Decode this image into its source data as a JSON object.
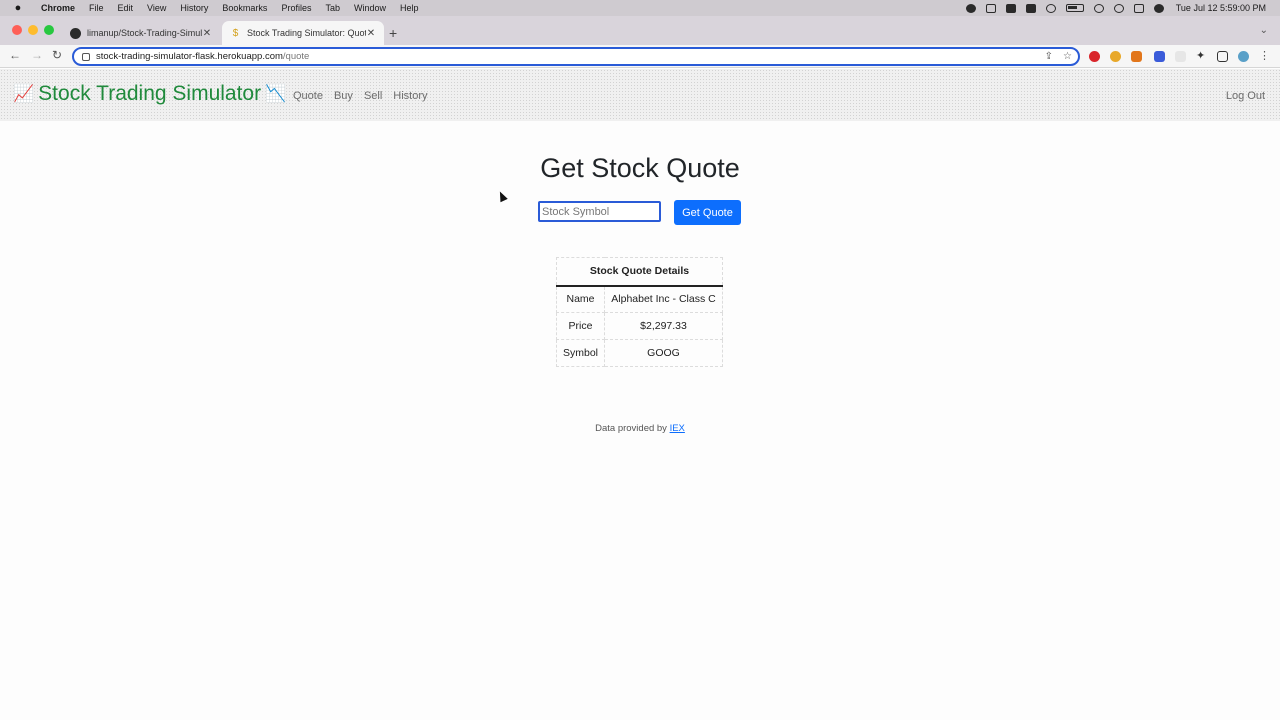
{
  "menubar": {
    "app": "Chrome",
    "items": [
      "File",
      "Edit",
      "View",
      "History",
      "Bookmarks",
      "Profiles",
      "Tab",
      "Window",
      "Help"
    ],
    "clock": "Tue Jul 12  5:59:00 PM"
  },
  "tabs": [
    {
      "title": "limanup/Stock-Trading-Simula",
      "icon": "github-icon",
      "active": false
    },
    {
      "title": "Stock Trading Simulator: Quote",
      "icon": "money-bag-icon",
      "active": true
    }
  ],
  "browser": {
    "url_host": "stock-trading-simulator-flask.herokuapp.com",
    "url_path": "/quote"
  },
  "navbar": {
    "brand": "Stock Trading Simulator",
    "brand_emoji_left": "📈",
    "brand_emoji_right": "📉",
    "links": [
      "Quote",
      "Buy",
      "Sell",
      "History"
    ],
    "logout": "Log Out"
  },
  "main": {
    "title": "Get Stock Quote",
    "input_placeholder": "Stock Symbol",
    "button_label": "Get Quote",
    "table": {
      "header": "Stock Quote Details",
      "rows": [
        {
          "label": "Name",
          "value": "Alphabet Inc - Class C"
        },
        {
          "label": "Price",
          "value": "$2,297.33"
        },
        {
          "label": "Symbol",
          "value": "GOOG"
        }
      ]
    }
  },
  "footer": {
    "text": "Data provided by",
    "link": "IEX"
  },
  "colors": {
    "brand_green": "#208a3c",
    "primary_blue": "#0d6efd"
  }
}
